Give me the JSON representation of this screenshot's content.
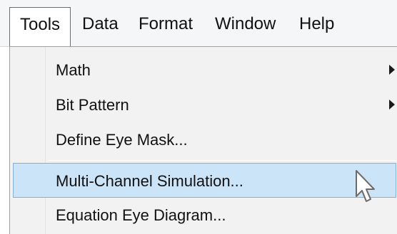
{
  "menubar": {
    "items": [
      {
        "label": "Tools"
      },
      {
        "label": "Data"
      },
      {
        "label": "Format"
      },
      {
        "label": "Window"
      },
      {
        "label": "Help"
      }
    ]
  },
  "tools_menu": {
    "items": [
      {
        "label": "Math",
        "has_submenu": true
      },
      {
        "label": "Bit Pattern",
        "has_submenu": true
      },
      {
        "label": "Define Eye Mask..."
      },
      {
        "label": "Multi-Channel Simulation...",
        "highlighted": true
      },
      {
        "label": "Equation Eye Diagram..."
      }
    ]
  },
  "cursor": {
    "icon": "mouse-pointer-icon"
  },
  "colors": {
    "highlight_fill": "#cce4f7",
    "highlight_border": "#7fb0dc",
    "menu_background": "#f2f2f2"
  }
}
